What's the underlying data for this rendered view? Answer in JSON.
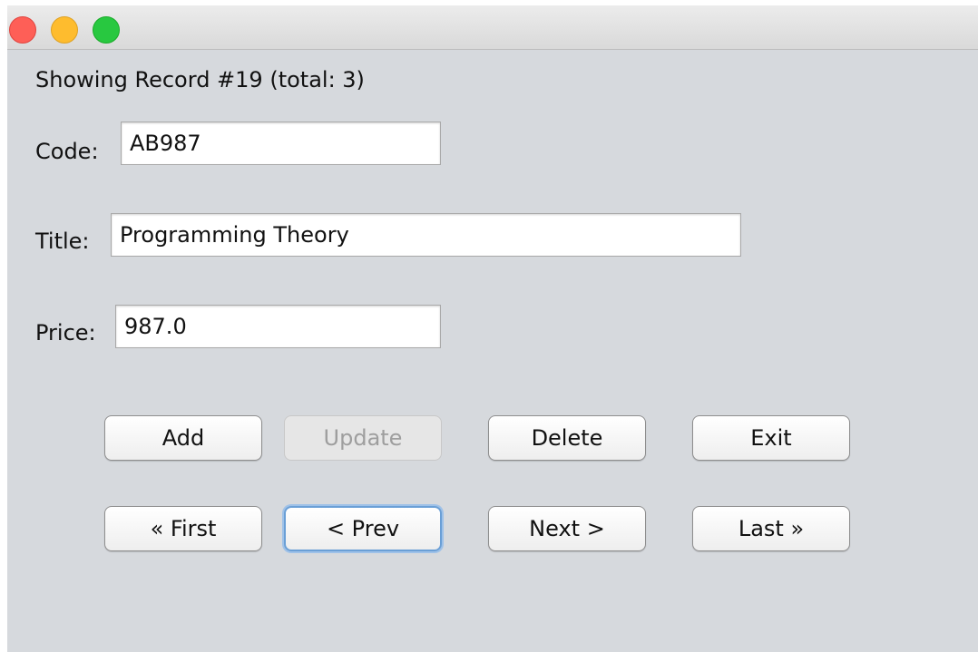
{
  "status": {
    "text": "Showing Record #19 (total: 3)"
  },
  "form": {
    "code": {
      "label": "Code:",
      "value": "AB987"
    },
    "title": {
      "label": "Title:",
      "value": "Programming Theory"
    },
    "price": {
      "label": "Price:",
      "value": "987.0"
    }
  },
  "actions": {
    "add": "Add",
    "update": "Update",
    "delete": "Delete",
    "exit": "Exit"
  },
  "navigation": {
    "first": "« First",
    "prev": "< Prev",
    "next": "Next >",
    "last": "Last »"
  }
}
